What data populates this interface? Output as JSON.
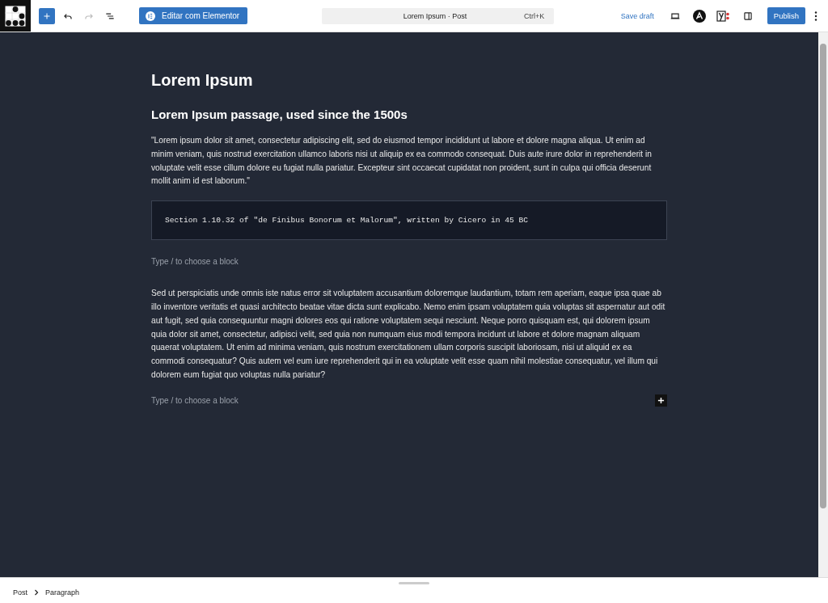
{
  "toolbar": {
    "elementor_button": "Editar com Elementor",
    "redo_disabled": true,
    "command_bar": {
      "title": "Lorem Ipsum · Post",
      "shortcut": "Ctrl+K"
    },
    "save_draft": "Save draft",
    "publish": "Publish"
  },
  "blocks": [
    {
      "kind": "title",
      "text": "Lorem Ipsum"
    },
    {
      "kind": "heading",
      "text": "Lorem Ipsum passage, used since the 1500s"
    },
    {
      "kind": "paragraph",
      "text": "\"Lorem ipsum dolor sit amet, consectetur adipiscing elit, sed do eiusmod tempor incididunt ut labore et dolore magna aliqua. Ut enim ad minim veniam, quis nostrud exercitation ullamco laboris nisi ut aliquip ex ea commodo consequat. Duis aute irure dolor in reprehenderit in voluptate velit esse cillum dolore eu fugiat nulla pariatur. Excepteur sint occaecat cupidatat non proident, sunt in culpa qui officia deserunt mollit anim id est laborum.\""
    },
    {
      "kind": "code",
      "text": "Section 1.10.32 of \"de Finibus Bonorum et Malorum\", written by Cicero in 45 BC"
    },
    {
      "kind": "placeholder",
      "text": "Type / to choose a block",
      "inserter": false
    },
    {
      "kind": "paragraph",
      "text": "Sed ut perspiciatis unde omnis iste natus error sit voluptatem accusantium doloremque laudantium, totam rem aperiam, eaque ipsa quae ab illo inventore veritatis et quasi architecto beatae vitae dicta sunt explicabo. Nemo enim ipsam voluptatem quia voluptas sit aspernatur aut odit aut fugit, sed quia consequuntur magni dolores eos qui ratione voluptatem sequi nesciunt. Neque porro quisquam est, qui dolorem ipsum quia dolor sit amet, consectetur, adipisci velit, sed quia non numquam eius modi tempora incidunt ut labore et dolore magnam aliquam quaerat voluptatem. Ut enim ad minima veniam, quis nostrum exercitationem ullam corporis suscipit laboriosam, nisi ut aliquid ex ea commodi consequatur? Quis autem vel eum iure reprehenderit qui in ea voluptate velit esse quam nihil molestiae consequatur, vel illum qui dolorem eum fugiat quo voluptas nulla pariatur?"
    },
    {
      "kind": "placeholder",
      "text": "Type / to choose a block",
      "inserter": true
    }
  ],
  "breadcrumb": [
    {
      "label": "Post"
    },
    {
      "label": "Paragraph"
    }
  ]
}
